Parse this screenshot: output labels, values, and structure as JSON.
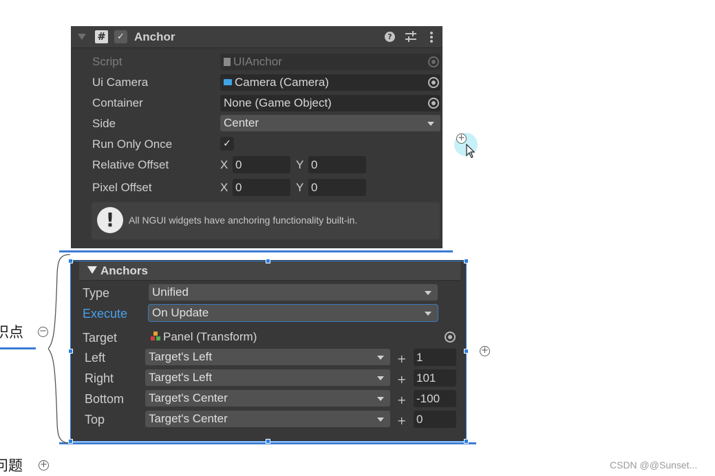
{
  "anchor_component": {
    "title": "Anchor",
    "enabled_check": "✓",
    "help_glyph": "?",
    "fields": {
      "script": {
        "label": "Script",
        "value": "UIAnchor"
      },
      "ui_camera": {
        "label": "Ui Camera",
        "value": "Camera (Camera)"
      },
      "container": {
        "label": "Container",
        "value": "None (Game Object)"
      },
      "side": {
        "label": "Side",
        "value": "Center"
      },
      "run_only_once": {
        "label": "Run Only Once",
        "checked": true,
        "glyph": "✓"
      },
      "relative_offset": {
        "label": "Relative Offset",
        "x_label": "X",
        "x": "0",
        "y_label": "Y",
        "y": "0"
      },
      "pixel_offset": {
        "label": "Pixel Offset",
        "x_label": "X",
        "x": "0",
        "y_label": "Y",
        "y": "0"
      }
    },
    "help_box": {
      "icon_glyph": "!",
      "text": "All NGUI widgets have anchoring functionality built-in."
    }
  },
  "anchors_section": {
    "title": "Anchors",
    "type": {
      "label": "Type",
      "value": "Unified"
    },
    "execute": {
      "label": "Execute",
      "value": "On Update"
    },
    "target": {
      "label": "Target",
      "value": "Panel (Transform)"
    },
    "rows": [
      {
        "label": "Left",
        "value": "Target's Left",
        "plus": "+",
        "offset": "1"
      },
      {
        "label": "Right",
        "value": "Target's Left",
        "plus": "+",
        "offset": "101"
      },
      {
        "label": "Bottom",
        "value": "Target's Center",
        "plus": "+",
        "offset": "-100"
      },
      {
        "label": "Top",
        "value": "Target's Center",
        "plus": "+",
        "offset": "0"
      }
    ]
  },
  "mindmap": {
    "node_1": "知识点",
    "node_2": "问题",
    "collapse_glyph": "−",
    "expand_glyph": "+"
  },
  "watermark": "CSDN @@Sunset...",
  "icons": {
    "component": "script-hash-icon",
    "help": "help-icon",
    "presets": "presets-sliders-icon",
    "menu": "kebab-menu-icon",
    "camera": "camera-icon",
    "transform": "transform-icon",
    "object_picker": "object-picker-icon"
  },
  "colors": {
    "inspector_bg": "#383838",
    "field_bg": "#2a2a2a",
    "dropdown_bg": "#515151",
    "highlight_label": "#4aa0ec",
    "selection_blue": "#2a7fe0",
    "mindmap_line": "#3b7bd4"
  }
}
